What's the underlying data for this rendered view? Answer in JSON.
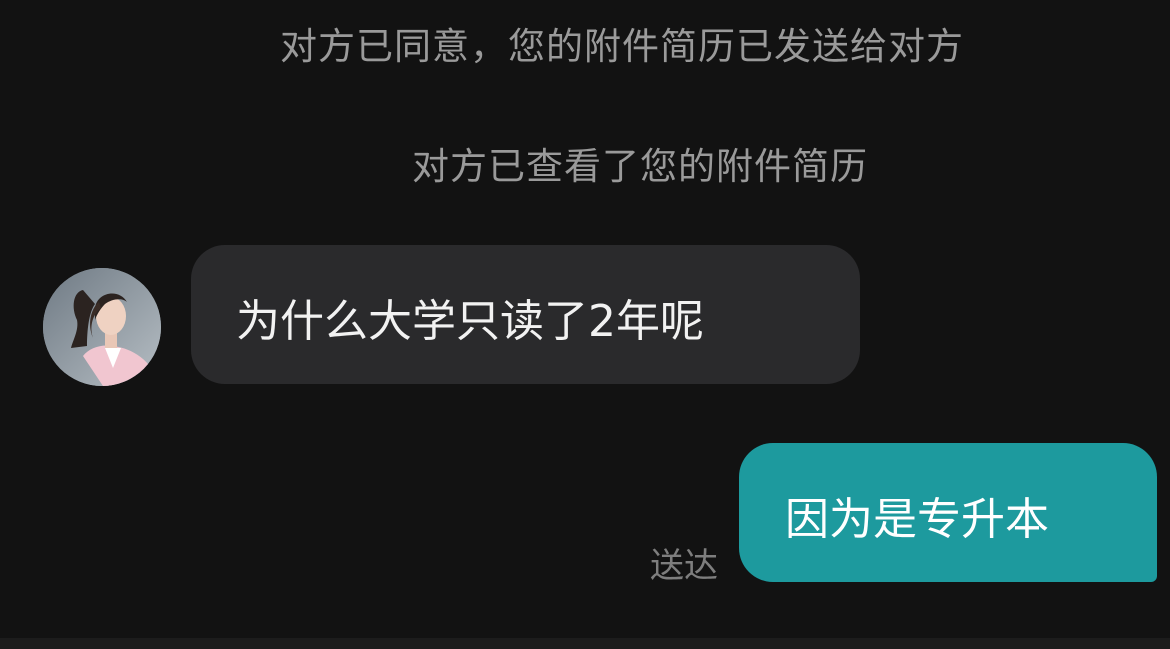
{
  "system_notes": [
    "对方已同意，您的附件简历已发送给对方",
    "对方已查看了您的附件简历"
  ],
  "received_message": {
    "text": "为什么大学只读了2年呢"
  },
  "sent_message": {
    "text": "因为是专升本",
    "status": "送达"
  },
  "colors": {
    "background": "#121212",
    "received_bubble": "#2a2a2c",
    "sent_bubble": "#1d9a9e",
    "system_text": "#9a9a9a",
    "status_text": "#7e7e7e"
  }
}
